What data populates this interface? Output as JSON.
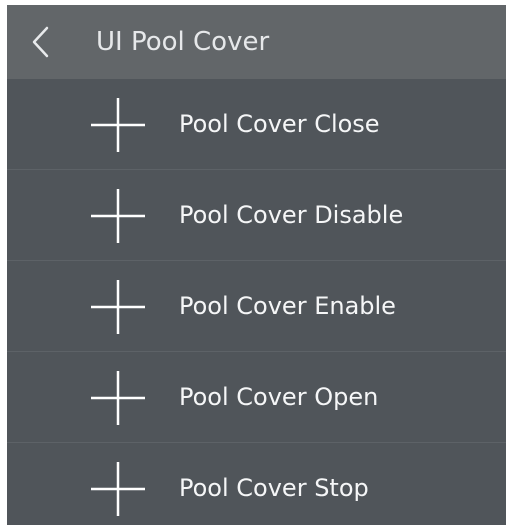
{
  "header": {
    "back_icon": "chevron-left-icon",
    "title": "UI Pool Cover"
  },
  "list": {
    "items": [
      {
        "label": "Pool Cover Close",
        "icon": "plus-icon"
      },
      {
        "label": "Pool Cover Disable",
        "icon": "plus-icon"
      },
      {
        "label": "Pool Cover Enable",
        "icon": "plus-icon"
      },
      {
        "label": "Pool Cover Open",
        "icon": "plus-icon"
      },
      {
        "label": "Pool Cover Stop",
        "icon": "plus-icon"
      }
    ]
  },
  "colors": {
    "panel_background": "#50555a",
    "header_background": "#626669",
    "divider": "#5d6267",
    "text": "#f5f6f7"
  }
}
